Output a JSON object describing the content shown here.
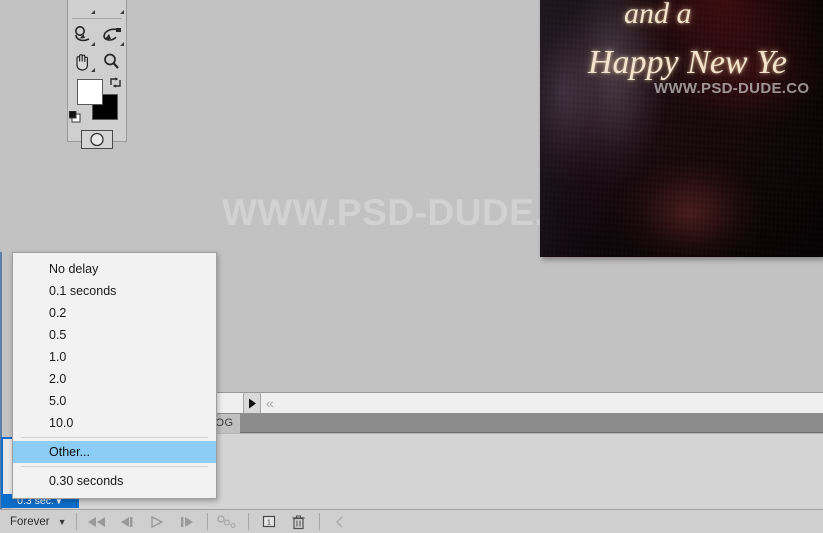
{
  "app": {
    "canvas_watermark": "WWW.PSD-DUDE.COM"
  },
  "tools_panel": {
    "tools": [
      {
        "name": "dodge-burn-tool",
        "label": "Dodge Tool"
      },
      {
        "name": "pen-path-tool",
        "label": "Pen Tool"
      },
      {
        "name": "hand-tool",
        "label": "Hand Tool"
      },
      {
        "name": "zoom-tool",
        "label": "Zoom Tool"
      }
    ],
    "foreground_color": "#ffffff",
    "background_color": "#000000",
    "swap_icon": "swap-colors-icon",
    "default_icon": "default-colors-icon",
    "quickmask_icon": "quick-mask-icon"
  },
  "artwork": {
    "line1": "and a",
    "line2": "Happy New Ye",
    "watermark": "WWW.PSD-DUDE.CO"
  },
  "panel": {
    "tab_label": "LOG",
    "options_arrow": "▶",
    "collapse_chevron": "«"
  },
  "frame": {
    "delay_badge": "0.3 sec.",
    "badge_caret": "▼"
  },
  "toolbar": {
    "loop_value": "Forever",
    "loop_caret": "▼",
    "buttons": [
      {
        "name": "select-first-frame-button",
        "icon": "rewind-icon"
      },
      {
        "name": "select-previous-frame-button",
        "icon": "previous-frame-icon"
      },
      {
        "name": "play-animation-button",
        "icon": "play-icon"
      },
      {
        "name": "select-next-frame-button",
        "icon": "next-frame-icon"
      },
      {
        "name": "tween-frames-button",
        "icon": "tween-icon"
      },
      {
        "name": "duplicate-frame-button",
        "icon": "duplicate-frame-icon"
      },
      {
        "name": "delete-frame-button",
        "icon": "trash-icon"
      }
    ]
  },
  "delay_menu": {
    "items": [
      {
        "label": "No delay",
        "selected": false,
        "divider_after": false
      },
      {
        "label": "0.1 seconds",
        "selected": false,
        "divider_after": false
      },
      {
        "label": "0.2",
        "selected": false,
        "divider_after": false
      },
      {
        "label": "0.5",
        "selected": false,
        "divider_after": false
      },
      {
        "label": "1.0",
        "selected": false,
        "divider_after": false
      },
      {
        "label": "2.0",
        "selected": false,
        "divider_after": false
      },
      {
        "label": "5.0",
        "selected": false,
        "divider_after": false
      },
      {
        "label": "10.0",
        "selected": false,
        "divider_after": true
      },
      {
        "label": "Other...",
        "selected": true,
        "divider_after": true
      },
      {
        "label": "0.30 seconds",
        "selected": false,
        "divider_after": false
      }
    ],
    "highlight_color": "#8ccdf5"
  }
}
